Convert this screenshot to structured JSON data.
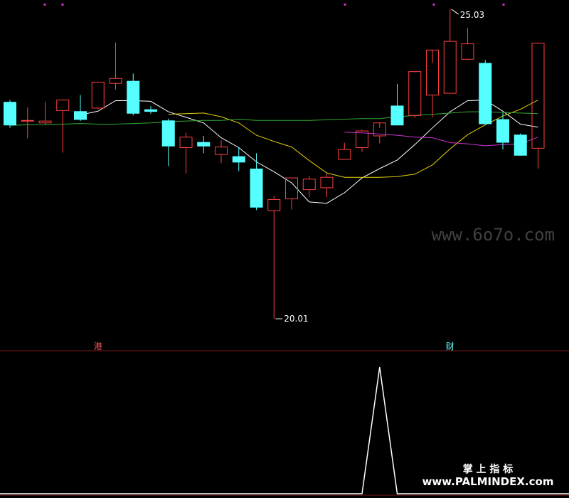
{
  "chart_data": {
    "type": "candlestick",
    "price_range": [
      19.7,
      25.1
    ],
    "annotations": {
      "high_label": "25.03",
      "low_label": "20.01",
      "high_index": 25,
      "low_index": 15
    },
    "bottom_markers": [
      {
        "label": "港",
        "index": 5,
        "color": "#ff5555"
      },
      {
        "label": "财",
        "index": 25,
        "color": "#66ffff"
      }
    ],
    "candles": [
      {
        "o": 23.52,
        "h": 23.55,
        "l": 23.1,
        "c": 23.14
      },
      {
        "o": 23.22,
        "h": 23.43,
        "l": 22.93,
        "c": 23.22
      },
      {
        "o": 23.18,
        "h": 23.52,
        "l": 23.15,
        "c": 23.21
      },
      {
        "o": 23.38,
        "h": 23.55,
        "l": 22.7,
        "c": 23.55
      },
      {
        "o": 23.37,
        "h": 23.63,
        "l": 23.21,
        "c": 23.23
      },
      {
        "o": 23.42,
        "h": 23.84,
        "l": 23.4,
        "c": 23.84
      },
      {
        "o": 23.82,
        "h": 24.48,
        "l": 23.72,
        "c": 23.9
      },
      {
        "o": 23.86,
        "h": 23.98,
        "l": 23.3,
        "c": 23.33
      },
      {
        "o": 23.4,
        "h": 23.45,
        "l": 23.33,
        "c": 23.36
      },
      {
        "o": 23.22,
        "h": 23.25,
        "l": 22.48,
        "c": 22.8
      },
      {
        "o": 22.78,
        "h": 23.02,
        "l": 22.36,
        "c": 22.95
      },
      {
        "o": 22.87,
        "h": 22.97,
        "l": 22.69,
        "c": 22.8
      },
      {
        "o": 22.67,
        "h": 22.9,
        "l": 22.53,
        "c": 22.79
      },
      {
        "o": 22.64,
        "h": 22.79,
        "l": 22.4,
        "c": 22.54
      },
      {
        "o": 22.44,
        "h": 22.69,
        "l": 21.77,
        "c": 21.81
      },
      {
        "o": 21.76,
        "h": 22.0,
        "l": 20.01,
        "c": 21.94
      },
      {
        "o": 21.95,
        "h": 22.28,
        "l": 21.78,
        "c": 22.29
      },
      {
        "o": 22.1,
        "h": 22.32,
        "l": 21.98,
        "c": 22.27
      },
      {
        "o": 22.13,
        "h": 22.36,
        "l": 21.98,
        "c": 22.3
      },
      {
        "o": 22.59,
        "h": 22.86,
        "l": 22.59,
        "c": 22.75
      },
      {
        "o": 22.78,
        "h": 23.07,
        "l": 22.71,
        "c": 23.05
      },
      {
        "o": 22.97,
        "h": 23.1,
        "l": 22.85,
        "c": 23.18
      },
      {
        "o": 23.46,
        "h": 23.81,
        "l": 23.17,
        "c": 23.14
      },
      {
        "o": 23.3,
        "h": 24.0,
        "l": 23.26,
        "c": 24.01
      },
      {
        "o": 23.63,
        "h": 24.15,
        "l": 23.27,
        "c": 24.36
      },
      {
        "o": 23.66,
        "h": 25.03,
        "l": 23.66,
        "c": 24.5
      },
      {
        "o": 24.21,
        "h": 24.72,
        "l": 24.2,
        "c": 24.46
      },
      {
        "o": 24.15,
        "h": 24.2,
        "l": 23.17,
        "c": 23.16
      },
      {
        "o": 23.24,
        "h": 23.34,
        "l": 22.75,
        "c": 22.86
      },
      {
        "o": 22.99,
        "h": 23.01,
        "l": 22.65,
        "c": 22.65
      },
      {
        "o": 22.77,
        "h": 24.46,
        "l": 22.44,
        "c": 24.47
      }
    ],
    "moving_averages": [
      {
        "name": "MA5",
        "color": "#ffffff",
        "values": [
          null,
          null,
          null,
          null,
          23.31,
          23.37,
          23.54,
          23.54,
          23.53,
          23.36,
          23.27,
          23.18,
          22.94,
          22.78,
          22.55,
          22.39,
          22.21,
          21.9,
          21.88,
          22.05,
          22.29,
          22.44,
          22.58,
          22.83,
          23.1,
          23.36,
          23.54,
          23.55,
          23.37,
          23.16,
          23.11
        ]
      },
      {
        "name": "MA10",
        "color": "#e6d000",
        "values": [
          null,
          null,
          null,
          null,
          null,
          null,
          null,
          null,
          null,
          23.32,
          23.33,
          23.34,
          23.28,
          23.18,
          22.98,
          22.88,
          22.79,
          22.57,
          22.37,
          22.3,
          22.3,
          22.3,
          22.31,
          22.35,
          22.5,
          22.76,
          22.99,
          23.15,
          23.29,
          23.4,
          23.55
        ]
      },
      {
        "name": "MA20",
        "color": "#cc33cc",
        "values": [
          null,
          null,
          null,
          null,
          null,
          null,
          null,
          null,
          null,
          null,
          null,
          null,
          null,
          null,
          null,
          null,
          null,
          null,
          null,
          23.03,
          23.02,
          23.0,
          22.98,
          22.95,
          22.94,
          22.86,
          22.84,
          22.81,
          22.83,
          22.84,
          22.95
        ]
      },
      {
        "name": "MA60",
        "color": "#33aa33",
        "values": [
          23.14,
          23.15,
          23.15,
          23.16,
          23.17,
          23.16,
          23.16,
          23.17,
          23.18,
          23.2,
          23.21,
          23.22,
          23.22,
          23.24,
          23.22,
          23.22,
          23.22,
          23.22,
          23.23,
          23.24,
          23.25,
          23.25,
          23.28,
          23.3,
          23.32,
          23.34,
          23.36,
          23.36,
          23.35,
          23.34,
          23.33
        ]
      }
    ],
    "indicator": {
      "color": "#ffffff",
      "range": [
        0,
        1
      ],
      "values": [
        0,
        0,
        0,
        0,
        0,
        0,
        0,
        0,
        0,
        0,
        0,
        0,
        0,
        0,
        0,
        0,
        0,
        0,
        0,
        0,
        0,
        1,
        0,
        0,
        0,
        0,
        0,
        0,
        0,
        0,
        0
      ]
    },
    "grid": false
  },
  "watermarks": {
    "main": "www.6o7o.com",
    "footer_title": "掌 上 指 标",
    "footer_url": "www.PALMINDEX.com"
  }
}
